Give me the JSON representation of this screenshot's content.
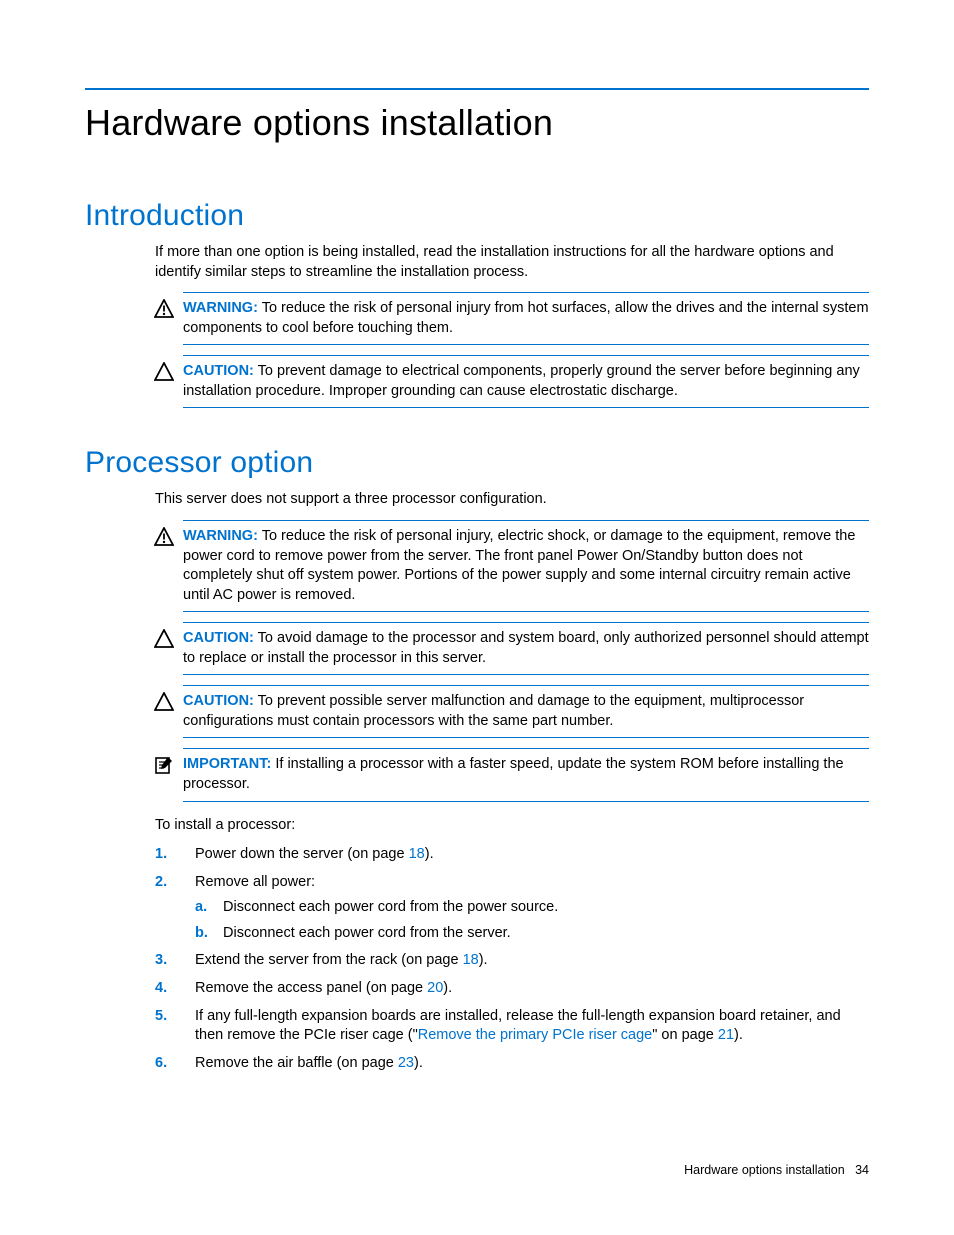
{
  "chapter_title": "Hardware options installation",
  "sections": {
    "intro": {
      "heading": "Introduction",
      "body": "If more than one option is being installed, read the installation instructions for all the hardware options and identify similar steps to streamline the installation process.",
      "warning": {
        "label": "WARNING:",
        "text": "To reduce the risk of personal injury from hot surfaces, allow the drives and the internal system components to cool before touching them."
      },
      "caution": {
        "label": "CAUTION:",
        "text": "To prevent damage to electrical components, properly ground the server before beginning any installation procedure. Improper grounding can cause electrostatic discharge."
      }
    },
    "processor": {
      "heading": "Processor option",
      "body": "This server does not support a three processor configuration.",
      "warning": {
        "label": "WARNING:",
        "text": "To reduce the risk of personal injury, electric shock, or damage to the equipment, remove the power cord to remove power from the server. The front panel Power On/Standby button does not completely shut off system power. Portions of the power supply and some internal circuitry remain active until AC power is removed."
      },
      "caution1": {
        "label": "CAUTION:",
        "text": "To avoid damage to the processor and system board, only authorized personnel should attempt to replace or install the processor in this server."
      },
      "caution2": {
        "label": "CAUTION:",
        "text": "To prevent possible server malfunction and damage to the equipment, multiprocessor configurations must contain processors with the same part number."
      },
      "important": {
        "label": "IMPORTANT:",
        "text": "If installing a processor with a faster speed, update the system ROM before installing the processor."
      },
      "lead": "To install a processor:",
      "steps": {
        "s1_a": "Power down the server (on page ",
        "s1_link": "18",
        "s1_b": ").",
        "s2": "Remove all power:",
        "s2a": "Disconnect each power cord from the power source.",
        "s2b": "Disconnect each power cord from the server.",
        "s3_a": "Extend the server from the rack (on page ",
        "s3_link": "18",
        "s3_b": ").",
        "s4_a": "Remove the access panel (on page ",
        "s4_link": "20",
        "s4_b": ").",
        "s5_a": "If any full-length expansion boards are installed, release the full-length expansion board retainer, and then remove the PCIe riser cage (\"",
        "s5_link1": "Remove the primary PCIe riser cage",
        "s5_mid": "\" on page ",
        "s5_link2": "21",
        "s5_b": ").",
        "s6_a": "Remove the air baffle (on page ",
        "s6_link": "23",
        "s6_b": ")."
      }
    }
  },
  "footer": {
    "title": "Hardware options installation",
    "page": "34"
  }
}
